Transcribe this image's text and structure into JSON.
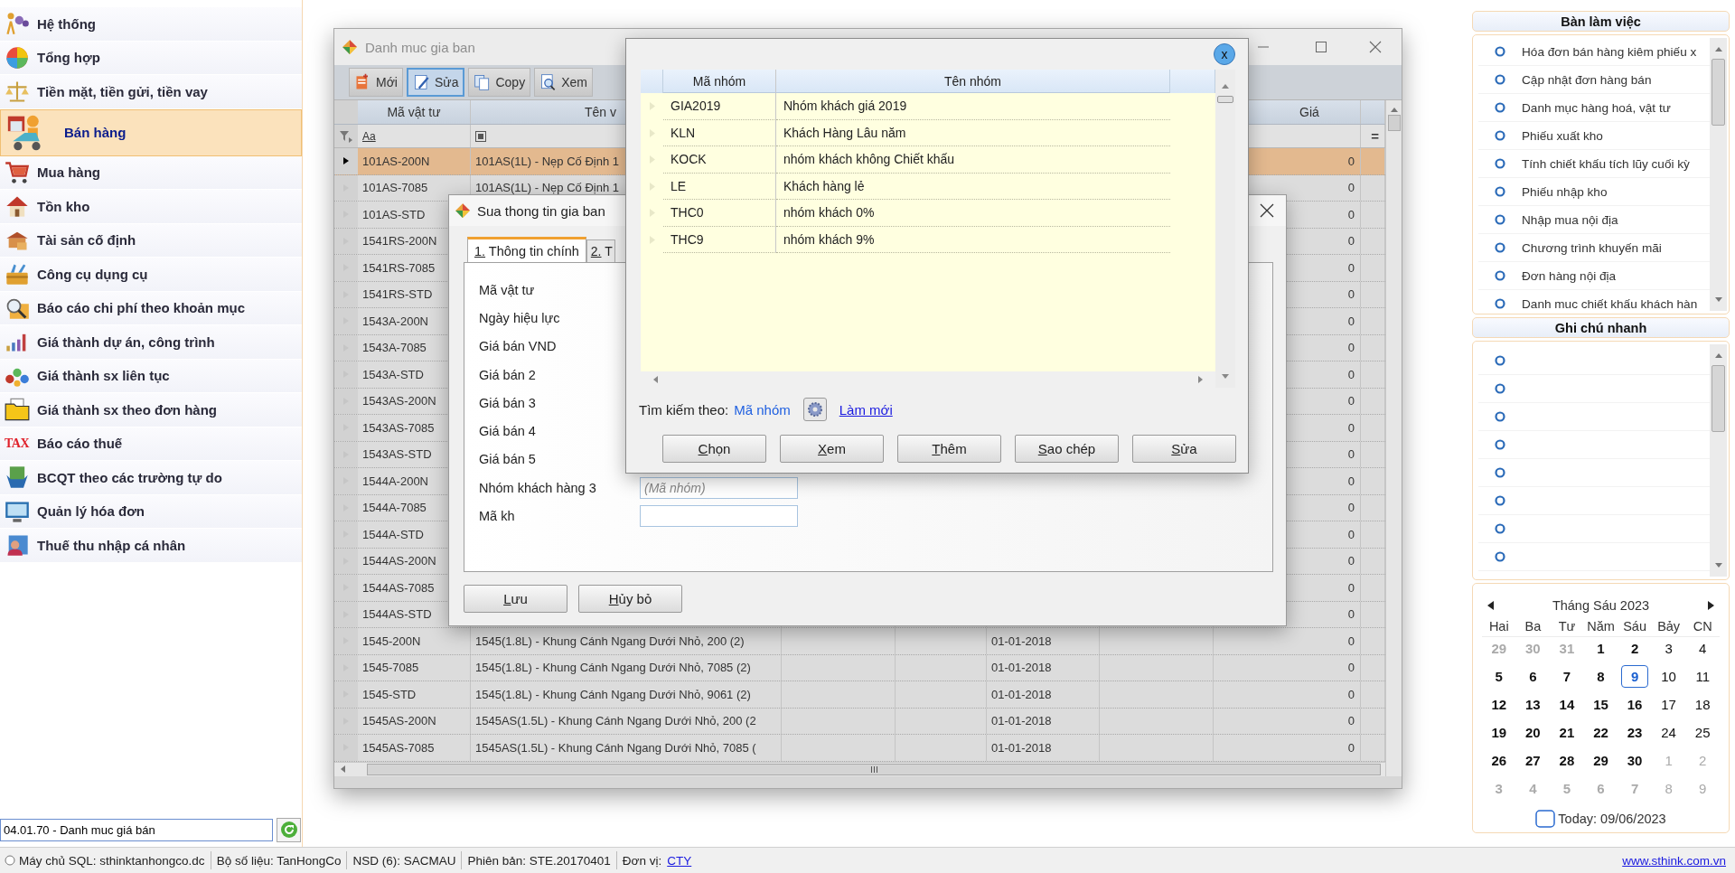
{
  "sidebar": {
    "items": [
      {
        "label": "Hệ thống",
        "selected": false
      },
      {
        "label": "Tổng hợp",
        "selected": false
      },
      {
        "label": "Tiền mặt, tiền gửi, tiền vay",
        "selected": false
      },
      {
        "label": "Bán hàng",
        "selected": true
      },
      {
        "label": "Mua hàng",
        "selected": false
      },
      {
        "label": "Tồn kho",
        "selected": false
      },
      {
        "label": "Tài sản cố định",
        "selected": false
      },
      {
        "label": "Công cụ dụng cụ",
        "selected": false
      },
      {
        "label": "Báo cáo chi phí theo khoản mục",
        "selected": false
      },
      {
        "label": "Giá thành dự án, công trình",
        "selected": false
      },
      {
        "label": "Giá thành sx liên tục",
        "selected": false
      },
      {
        "label": "Giá thành sx theo đơn hàng",
        "selected": false
      },
      {
        "label": "Báo cáo thuế",
        "icon_text": "TAX",
        "selected": false
      },
      {
        "label": "BCQT theo các trường tự do",
        "selected": false
      },
      {
        "label": "Quản lý hóa đơn",
        "selected": false
      },
      {
        "label": "Thuế thu nhập cá nhân",
        "selected": false
      }
    ]
  },
  "command_field": {
    "value": "04.01.70 - Danh muc giá bán"
  },
  "main_window": {
    "title": "Danh muc gia ban",
    "toolbar": [
      {
        "label": "Mới",
        "selected": false
      },
      {
        "label": "Sửa",
        "selected": true
      },
      {
        "label": "Copy",
        "selected": false
      },
      {
        "label": "Xem",
        "selected": false
      }
    ],
    "grid": {
      "header": {
        "code": "Mã vật tư",
        "name": "Tên v",
        "price": "Giá"
      },
      "filter": {
        "code_hint": "Aa",
        "price_hint": "="
      },
      "rows": [
        {
          "code": "101AS-200N",
          "name": "101AS(1L) - Nẹp Cố Định 1",
          "price": "0",
          "selected": true
        },
        {
          "code": "101AS-7085",
          "name": "101AS(1L) - Nẹp Cố Định 1",
          "price": "0",
          "selected": false
        },
        {
          "code": "101AS-STD",
          "price": "0",
          "selected": false
        },
        {
          "code": "1541RS-200N",
          "price": "0",
          "selected": false
        },
        {
          "code": "1541RS-7085",
          "price": "0",
          "selected": false
        },
        {
          "code": "1541RS-STD",
          "price": "0",
          "selected": false
        },
        {
          "code": "1543A-200N",
          "price": "0",
          "selected": false
        },
        {
          "code": "1543A-7085",
          "price": "0",
          "selected": false
        },
        {
          "code": "1543A-STD",
          "price": "0",
          "selected": false
        },
        {
          "code": "1543AS-200N",
          "price": "0",
          "selected": false
        },
        {
          "code": "1543AS-7085",
          "price": "0",
          "selected": false
        },
        {
          "code": "1543AS-STD",
          "price": "0",
          "selected": false
        },
        {
          "code": "1544A-200N",
          "price": "0",
          "selected": false
        },
        {
          "code": "1544A-7085",
          "price": "0",
          "selected": false
        },
        {
          "code": "1544A-STD",
          "price": "0",
          "selected": false
        },
        {
          "code": "1544AS-200N",
          "price": "0",
          "selected": false
        },
        {
          "code": "1544AS-7085",
          "price": "0",
          "selected": false
        },
        {
          "code": "1544AS-STD",
          "price": "0",
          "selected": false
        },
        {
          "code": "1545-200N",
          "name": "1545(1.8L) - Khung Cánh Ngang Dưới Nhỏ, 200 (2)",
          "date": "01-01-2018",
          "price": "0",
          "selected": false
        },
        {
          "code": "1545-7085",
          "name": "1545(1.8L) - Khung Cánh Ngang Dưới Nhỏ, 7085 (2)",
          "date": "01-01-2018",
          "price": "0",
          "selected": false
        },
        {
          "code": "1545-STD",
          "name": "1545(1.8L) - Khung Cánh Ngang Dưới Nhỏ, 9061 (2)",
          "date": "01-01-2018",
          "price": "0",
          "selected": false
        },
        {
          "code": "1545AS-200N",
          "name": "1545AS(1.5L) - Khung Cánh Ngang Dưới Nhỏ, 200 (2",
          "date": "01-01-2018",
          "price": "0",
          "selected": false
        },
        {
          "code": "1545AS-7085",
          "name": "1545AS(1.5L) - Khung Cánh Ngang Dưới Nhỏ, 7085 (",
          "date": "01-01-2018",
          "price": "0",
          "selected": false
        }
      ]
    }
  },
  "edit_dialog": {
    "title": "Sua thong tin gia ban",
    "tabs": [
      {
        "label": "1. Thông tin chính",
        "selected": true
      },
      {
        "label": "2. T",
        "selected": false
      }
    ],
    "fields": [
      {
        "label": "Mã vật tư"
      },
      {
        "label": "Ngày hiệu lực"
      },
      {
        "label": "Giá bán VND"
      },
      {
        "label": "Giá bán 2"
      },
      {
        "label": "Giá bán 3"
      },
      {
        "label": "Giá bán 4"
      },
      {
        "label": "Giá bán 5"
      },
      {
        "label": "Nhóm khách hàng 3",
        "kind": "input",
        "placeholder": "(Mã nhóm)"
      },
      {
        "label": "Mã kh",
        "kind": "input"
      }
    ],
    "buttons": [
      "Lưu",
      "Hủy bỏ"
    ]
  },
  "lookup_popup": {
    "close": "x",
    "columns": [
      "Mã nhóm",
      "Tên nhóm"
    ],
    "rows": [
      {
        "code": "GIA2019",
        "name": "Nhóm khách giá 2019"
      },
      {
        "code": "KLN",
        "name": "Khách Hàng Lâu năm"
      },
      {
        "code": "KOCK",
        "name": "nhóm khách không Chiết khấu"
      },
      {
        "code": "LE",
        "name": "Khách hàng lẻ"
      },
      {
        "code": "THC0",
        "name": "nhóm khách 0%"
      },
      {
        "code": "THC9",
        "name": "nhóm khách 9%"
      }
    ],
    "search_label": "Tìm kiếm theo:",
    "search_field": "Mã nhóm",
    "refresh_link": "Làm mới",
    "buttons": [
      "Chọn",
      "Xem",
      "Thêm",
      "Sao chép",
      "Sửa"
    ]
  },
  "workspace": {
    "title": "Bàn làm việc",
    "items": [
      "Hóa đơn bán hàng kiêm phiếu x",
      "Cập nhật đơn hàng bán",
      "Danh mục hàng hoá, vật tư",
      "Phiếu xuất kho",
      "Tính chiết khấu tích lũy cuối kỳ",
      "Phiếu nhập kho",
      "Nhập mua nội địa",
      "Chương trình khuyến mãi",
      "Đơn hàng nội địa",
      "Danh muc chiết khấu khách hàn"
    ]
  },
  "quick_notes": {
    "title": "Ghi chú nhanh",
    "items": [
      {
        "kind": "blank"
      },
      {
        "kind": "blank"
      },
      {
        "kind": "blank"
      },
      {
        "kind": "blank"
      },
      {
        "kind": "blank"
      },
      {
        "kind": "blank"
      },
      {
        "kind": "blank"
      },
      {
        "kind": "blank"
      }
    ]
  },
  "calendar": {
    "month": "Tháng Sáu 2023",
    "weekdays": [
      "Hai",
      "Ba",
      "Tư",
      "Năm",
      "Sáu",
      "Bảy",
      "CN"
    ],
    "weeks": [
      [
        {
          "day": "29",
          "other_month": true,
          "selected": false
        },
        {
          "day": "30",
          "other_month": true,
          "selected": false
        },
        {
          "day": "31",
          "other_month": true,
          "selected": false
        },
        {
          "day": "1",
          "other_month": false,
          "selected": false
        },
        {
          "day": "2",
          "other_month": false,
          "selected": false
        },
        {
          "day": "3",
          "other_month": false,
          "selected": false
        },
        {
          "day": "4",
          "other_month": false,
          "selected": false
        }
      ],
      [
        {
          "day": "5",
          "other_month": false,
          "selected": false
        },
        {
          "day": "6",
          "other_month": false,
          "selected": false
        },
        {
          "day": "7",
          "other_month": false,
          "selected": false
        },
        {
          "day": "8",
          "other_month": false,
          "selected": false
        },
        {
          "day": "9",
          "other_month": false,
          "selected": true
        },
        {
          "day": "10",
          "other_month": false,
          "selected": false
        },
        {
          "day": "11",
          "other_month": false,
          "selected": false
        }
      ],
      [
        {
          "day": "12",
          "other_month": false,
          "selected": false
        },
        {
          "day": "13",
          "other_month": false,
          "selected": false
        },
        {
          "day": "14",
          "other_month": false,
          "selected": false
        },
        {
          "day": "15",
          "other_month": false,
          "selected": false
        },
        {
          "day": "16",
          "other_month": false,
          "selected": false
        },
        {
          "day": "17",
          "other_month": false,
          "selected": false
        },
        {
          "day": "18",
          "other_month": false,
          "selected": false
        }
      ],
      [
        {
          "day": "19",
          "other_month": false,
          "selected": false
        },
        {
          "day": "20",
          "other_month": false,
          "selected": false
        },
        {
          "day": "21",
          "other_month": false,
          "selected": false
        },
        {
          "day": "22",
          "other_month": false,
          "selected": false
        },
        {
          "day": "23",
          "other_month": false,
          "selected": false
        },
        {
          "day": "24",
          "other_month": false,
          "selected": false
        },
        {
          "day": "25",
          "other_month": false,
          "selected": false
        }
      ],
      [
        {
          "day": "26",
          "other_month": false,
          "selected": false
        },
        {
          "day": "27",
          "other_month": false,
          "selected": false
        },
        {
          "day": "28",
          "other_month": false,
          "selected": false
        },
        {
          "day": "29",
          "other_month": false,
          "selected": false
        },
        {
          "day": "30",
          "other_month": false,
          "selected": false
        },
        {
          "day": "1",
          "other_month": true,
          "selected": false
        },
        {
          "day": "2",
          "other_month": true,
          "selected": false
        }
      ],
      [
        {
          "day": "3",
          "other_month": true,
          "selected": false
        },
        {
          "day": "4",
          "other_month": true,
          "selected": false
        },
        {
          "day": "5",
          "other_month": true,
          "selected": false
        },
        {
          "day": "6",
          "other_month": true,
          "selected": false
        },
        {
          "day": "7",
          "other_month": true,
          "selected": false
        },
        {
          "day": "8",
          "other_month": true,
          "selected": false
        },
        {
          "day": "9",
          "other_month": true,
          "selected": false
        }
      ]
    ],
    "today": "Today: 09/06/2023"
  },
  "status_bar": {
    "items": [
      "Máy chủ SQL: sthinktanhongco.dc",
      "Bộ số liệu: TanHongCo",
      "NSD (6): SACMAU",
      "Phiên bản: STE.20170401"
    ],
    "unit_label": "Đơn vị:",
    "unit_link": "CTY",
    "website": "www.sthink.com.vn"
  }
}
